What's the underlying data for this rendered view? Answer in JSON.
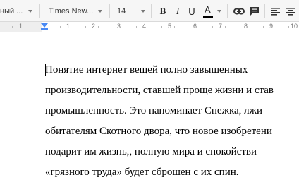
{
  "toolbar": {
    "style_dropdown": "ный ...",
    "font_dropdown": "Times New...",
    "font_size": "14",
    "bold_label": "B",
    "italic_label": "I",
    "underline_label": "U",
    "text_color_label": "A",
    "text_color_hex": "#000000"
  },
  "ruler": {
    "numbers": [
      "1",
      "1",
      "2",
      "3",
      "4",
      "5",
      "6",
      "7",
      "8",
      "9",
      "10"
    ]
  },
  "document": {
    "lines": [
      "Понятие интернет вещей полно завышенных ",
      "производительности, ставшей проще жизни и став",
      "промышленность. Это напоминает Снежка, лжи",
      "обитателям Скотного двора, что новое изобретени",
      "подарит им жизнь,, полную мира и спокойстви",
      "«грязного труда» будет сброшен с их спин."
    ]
  }
}
